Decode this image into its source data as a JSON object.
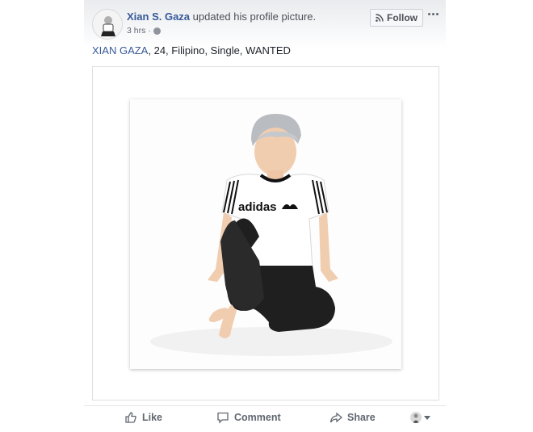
{
  "post": {
    "author_name": "Xian S. Gaza",
    "action_text": " updated his profile picture.",
    "time": "3 hrs",
    "separator": "·",
    "follow_label": "Follow",
    "caption_tag": "XIAN GAZA",
    "caption_rest": ", 24, Filipino, Single, WANTED",
    "shirt_text": "adidas"
  },
  "actions": {
    "like_label": "Like",
    "comment_label": "Comment",
    "share_label": "Share"
  },
  "icons": {
    "avatar": "profile-avatar",
    "privacy": "globe-icon",
    "follow": "rss-icon",
    "more": "more-options-icon",
    "like": "thumbs-up-icon",
    "comment": "comment-bubble-icon",
    "share": "share-arrow-icon",
    "reaction": "chevron-down-icon"
  },
  "colors": {
    "link_blue": "#365899",
    "muted_text": "#616770",
    "border": "#dddfe2"
  }
}
